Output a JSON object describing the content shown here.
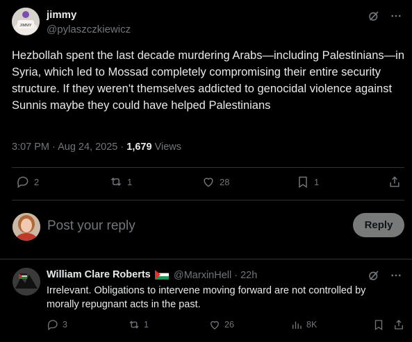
{
  "post": {
    "author_name": "jimmy",
    "author_handle": "@pylaszczkiewicz",
    "avatar_text": "JIMMY",
    "text": "Hezbollah spent the last decade murdering Arabs—including Palestinians—in Syria, which led to Mossad completely compromising their entire security structure. If they weren't themselves addicted to genocidal violence against Sunnis maybe they could have helped Palestinians",
    "timestamp": "3:07 PM · Aug 24, 2025 · ",
    "views_count": "1,679",
    "views_label": " Views",
    "actions": {
      "replies": "2",
      "reposts": "1",
      "likes": "28",
      "bookmarks": "1"
    }
  },
  "composer": {
    "placeholder": "Post your reply",
    "button_label": "Reply"
  },
  "reply": {
    "author_name": "William Clare Roberts",
    "author_handle": "@MarxinHell · 22h",
    "text": "Irrelevant. Obligations to intervene moving forward are not controlled by morally repugnant acts in the past.",
    "actions": {
      "replies": "3",
      "reposts": "1",
      "likes": "26",
      "views": "8K"
    }
  },
  "colors": {
    "background": "#000000",
    "text_primary": "#e7e9ea",
    "text_secondary": "#71767b",
    "divider": "#2f3336",
    "reply_button_bg": "#787a7a"
  },
  "icons": [
    "grok-icon",
    "more-icon",
    "reply-icon",
    "repost-icon",
    "like-icon",
    "bookmark-icon",
    "share-icon",
    "views-icon",
    "palestine-flag-icon"
  ]
}
